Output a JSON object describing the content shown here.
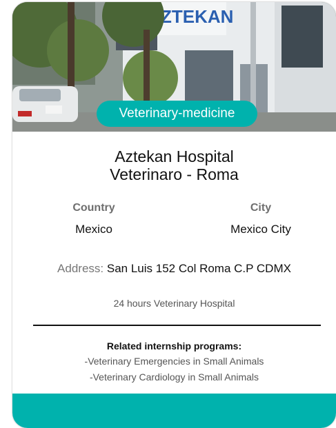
{
  "colors": {
    "accent": "#00b2ad",
    "footer": "#00b2ad"
  },
  "card": {
    "image_sign_text": "ZTEKAN",
    "category_badge": "Veterinary-medicine",
    "title_line1": "Aztekan Hospital",
    "title_line2": "Veterinaro - Roma",
    "country_label": "Country",
    "country_value": "Mexico",
    "city_label": "City",
    "city_value": "Mexico City",
    "address_label": "Address:",
    "address_value": "San Luis 152 Col Roma C.P CDMX",
    "description": "24 hours Veterinary Hospital",
    "related_title": "Related internship programs:",
    "programs": [
      "-Veterinary Emergencies in Small Animals",
      "-Veterinary Cardiology in Small Animals"
    ]
  }
}
